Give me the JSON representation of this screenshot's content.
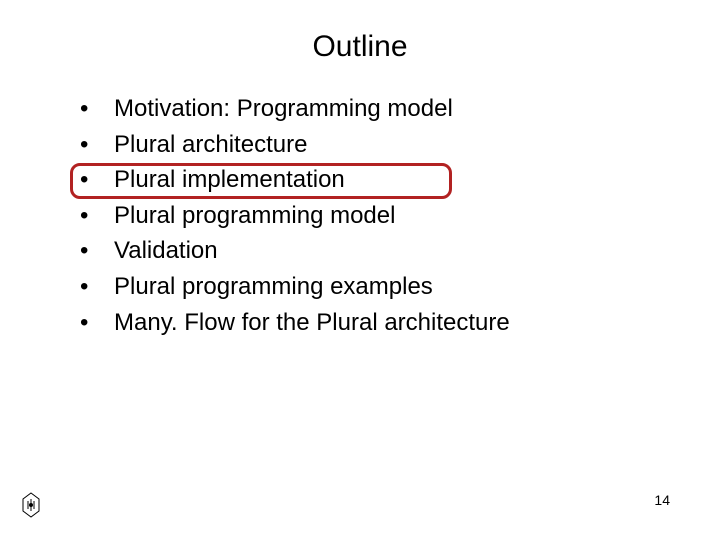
{
  "slide": {
    "title": "Outline",
    "bullets": [
      "Motivation: Programming model",
      "Plural architecture",
      "Plural implementation",
      "Plural programming model",
      "Validation",
      "Plural programming examples",
      "Many. Flow for the Plural architecture"
    ],
    "highlighted_index": 2,
    "page_number": "14"
  }
}
